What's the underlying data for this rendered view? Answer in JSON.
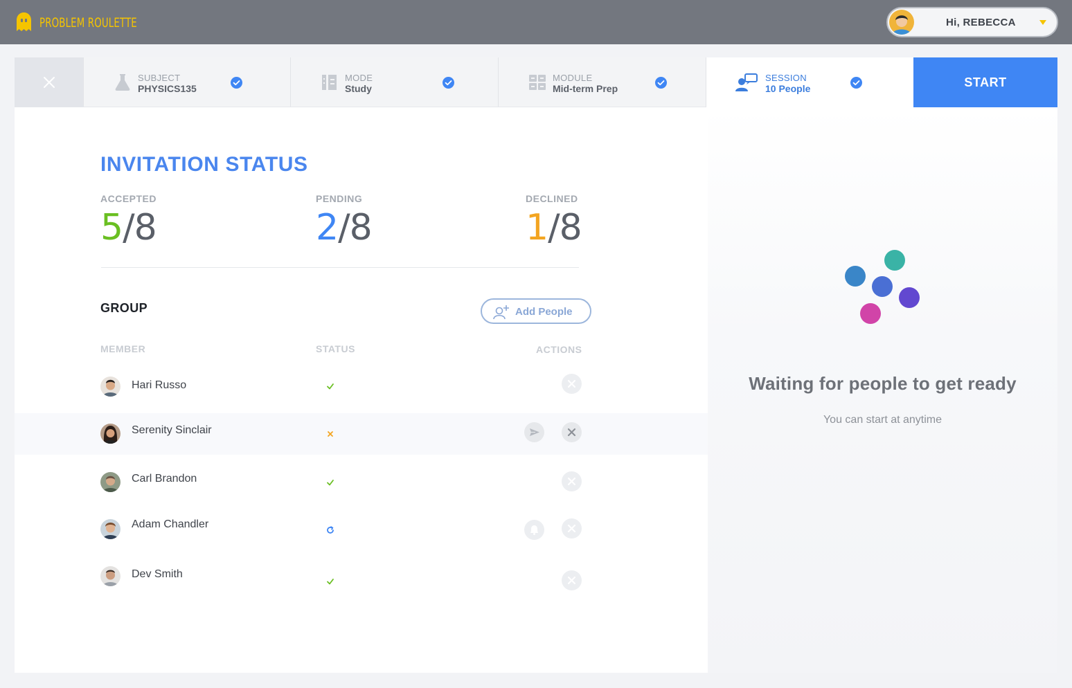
{
  "app": {
    "name": "PROBLEM ROULETTE",
    "greeting": "Hi, REBECCA",
    "colors": {
      "brand_yellow": "#f5c400",
      "accent_blue": "#3f86f4",
      "accepted_green": "#6abf22",
      "declined_orange": "#f3a521"
    }
  },
  "steps": [
    {
      "label": "SUBJECT",
      "value": "PHYSICS135",
      "icon": "flask-icon",
      "done": true
    },
    {
      "label": "MODE",
      "value": "Study",
      "icon": "book-icon",
      "done": true
    },
    {
      "label": "MODULE",
      "value": "Mid-term Prep",
      "icon": "grid-icon",
      "done": true
    },
    {
      "label": "SESSION",
      "value": "10 People",
      "icon": "people-chat-icon",
      "done": true,
      "active": true
    }
  ],
  "start_label": "START",
  "invitation": {
    "title": "INVITATION STATUS",
    "accepted": {
      "label": "ACCEPTED",
      "count": "5",
      "total": "/8"
    },
    "pending": {
      "label": "PENDING",
      "count": "2",
      "total": "/8"
    },
    "declined": {
      "label": "DECLINED",
      "count": "1",
      "total": "/8"
    }
  },
  "group": {
    "title": "GROUP",
    "add_label": "Add People",
    "columns": {
      "member": "MEMBER",
      "status": "STATUS",
      "actions": "ACTIONS"
    },
    "members": [
      {
        "name": "Hari Russo",
        "status": "accepted",
        "status_icon": "check-icon",
        "actions": [
          "remove"
        ]
      },
      {
        "name": "Serenity Sinclair",
        "status": "declined",
        "status_icon": "cross-icon",
        "actions": [
          "resend",
          "remove"
        ]
      },
      {
        "name": "Carl Brandon",
        "status": "accepted",
        "status_icon": "check-icon",
        "actions": [
          "remove"
        ]
      },
      {
        "name": "Adam Chandler",
        "status": "pending",
        "status_icon": "refresh-icon",
        "actions": [
          "remind",
          "remove"
        ]
      },
      {
        "name": "Dev Smith",
        "status": "accepted",
        "status_icon": "check-icon",
        "actions": [
          "remove"
        ]
      }
    ]
  },
  "waiting": {
    "title": "Waiting for people to get ready",
    "subtitle": "You can start at anytime",
    "dot_colors": [
      "#3ab3a6",
      "#3a86c8",
      "#4a6fd4",
      "#6248d0",
      "#d144a8"
    ]
  }
}
